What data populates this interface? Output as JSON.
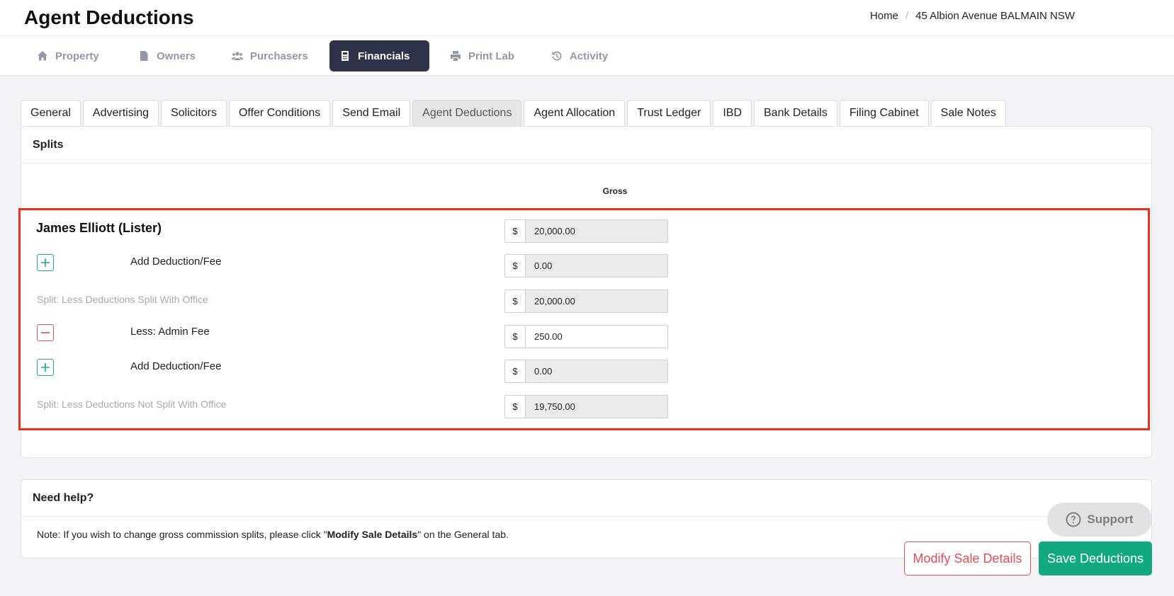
{
  "header": {
    "title": "Agent Deductions",
    "breadcrumb": [
      "Home",
      "45 Albion Avenue BALMAIN NSW"
    ]
  },
  "nav": {
    "items": [
      {
        "label": "Property",
        "icon": "home-icon"
      },
      {
        "label": "Owners",
        "icon": "file-icon"
      },
      {
        "label": "Purchasers",
        "icon": "users-icon"
      },
      {
        "label": "Financials",
        "icon": "calculator-icon",
        "active": true
      },
      {
        "label": "Print Lab",
        "icon": "printer-icon"
      },
      {
        "label": "Activity",
        "icon": "history-icon"
      }
    ]
  },
  "subtabs": [
    "General",
    "Advertising",
    "Solicitors",
    "Offer Conditions",
    "Send Email",
    "Agent Deductions",
    "Agent Allocation",
    "Trust Ledger",
    "IBD",
    "Bank Details",
    "Filing Cabinet",
    "Sale Notes"
  ],
  "active_subtab": "Agent Deductions",
  "splits": {
    "title": "Splits",
    "column_header": "Gross",
    "agent_name": "James Elliott (Lister)",
    "currency": "$",
    "gross_value": "20,000.00",
    "rows": [
      {
        "label": "Add Deduction/Fee",
        "value": "0.00",
        "action": "add"
      },
      {
        "label": "Split: Less Deductions Split With Office",
        "value": "20,000.00"
      },
      {
        "label": "Less: Admin Fee",
        "value": "250.00",
        "action": "remove"
      },
      {
        "label": "Add Deduction/Fee",
        "value": "0.00",
        "action": "add"
      },
      {
        "label": "Split: Less Deductions Not Split With Office",
        "value": "19,750.00"
      }
    ]
  },
  "help": {
    "title": "Need help?",
    "note_prefix": "Note: If you wish to change gross commission splits, please click \"",
    "note_bold": "Modify Sale Details",
    "note_suffix": "\" on the General tab."
  },
  "support_label": "Support",
  "buttons": {
    "modify": "Modify Sale Details",
    "save": "Save Deductions"
  },
  "colors": {
    "accent": "#13a97f",
    "danger": "#e44c57",
    "nav_active": "#2f3349",
    "highlight": "#e8321d"
  }
}
